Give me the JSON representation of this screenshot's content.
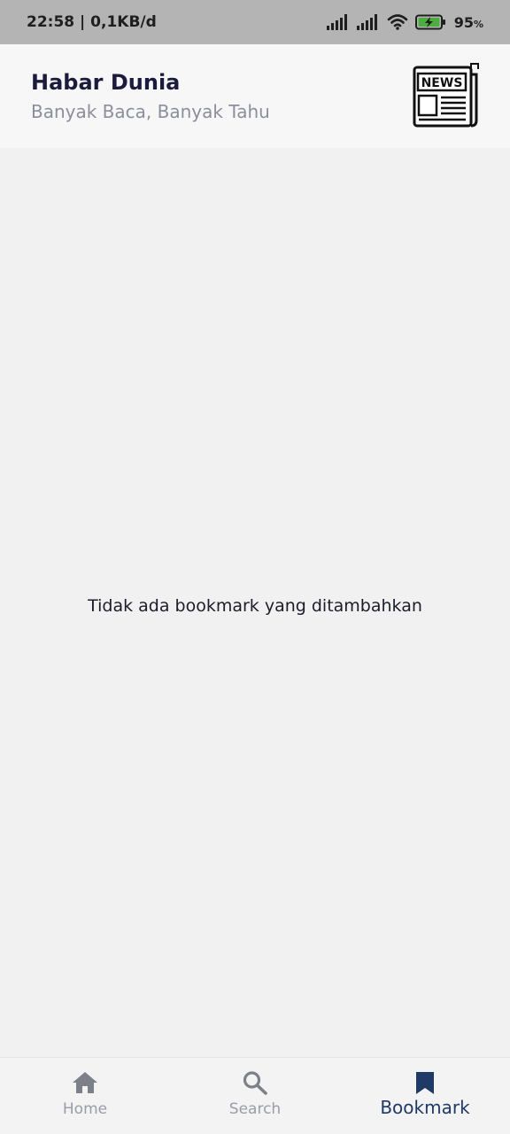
{
  "status_bar": {
    "time_speed": "22:58 | 0,1KB/d",
    "battery_percent": "95",
    "battery_unit": "%",
    "icons": [
      "signal-icon",
      "signal-icon",
      "wifi-icon",
      "battery-charging-icon"
    ]
  },
  "header": {
    "title": "Habar Dunia",
    "subtitle": "Banyak Baca, Banyak Tahu",
    "logo_text": "NEWS",
    "logo_icon": "newspaper-icon"
  },
  "content": {
    "empty_message": "Tidak ada bookmark yang ditambahkan"
  },
  "bottom_nav": {
    "items": [
      {
        "label": "Home",
        "icon": "home-icon",
        "active": false
      },
      {
        "label": "Search",
        "icon": "search-icon",
        "active": false
      },
      {
        "label": "Bookmark",
        "icon": "bookmark-icon",
        "active": true
      }
    ]
  },
  "colors": {
    "title": "#1c1b3e",
    "subtitle": "#8c8e9c",
    "active_nav": "#1f3a66",
    "inactive_nav": "#9a9ca6",
    "status_bar_bg": "#b4b4b4"
  }
}
